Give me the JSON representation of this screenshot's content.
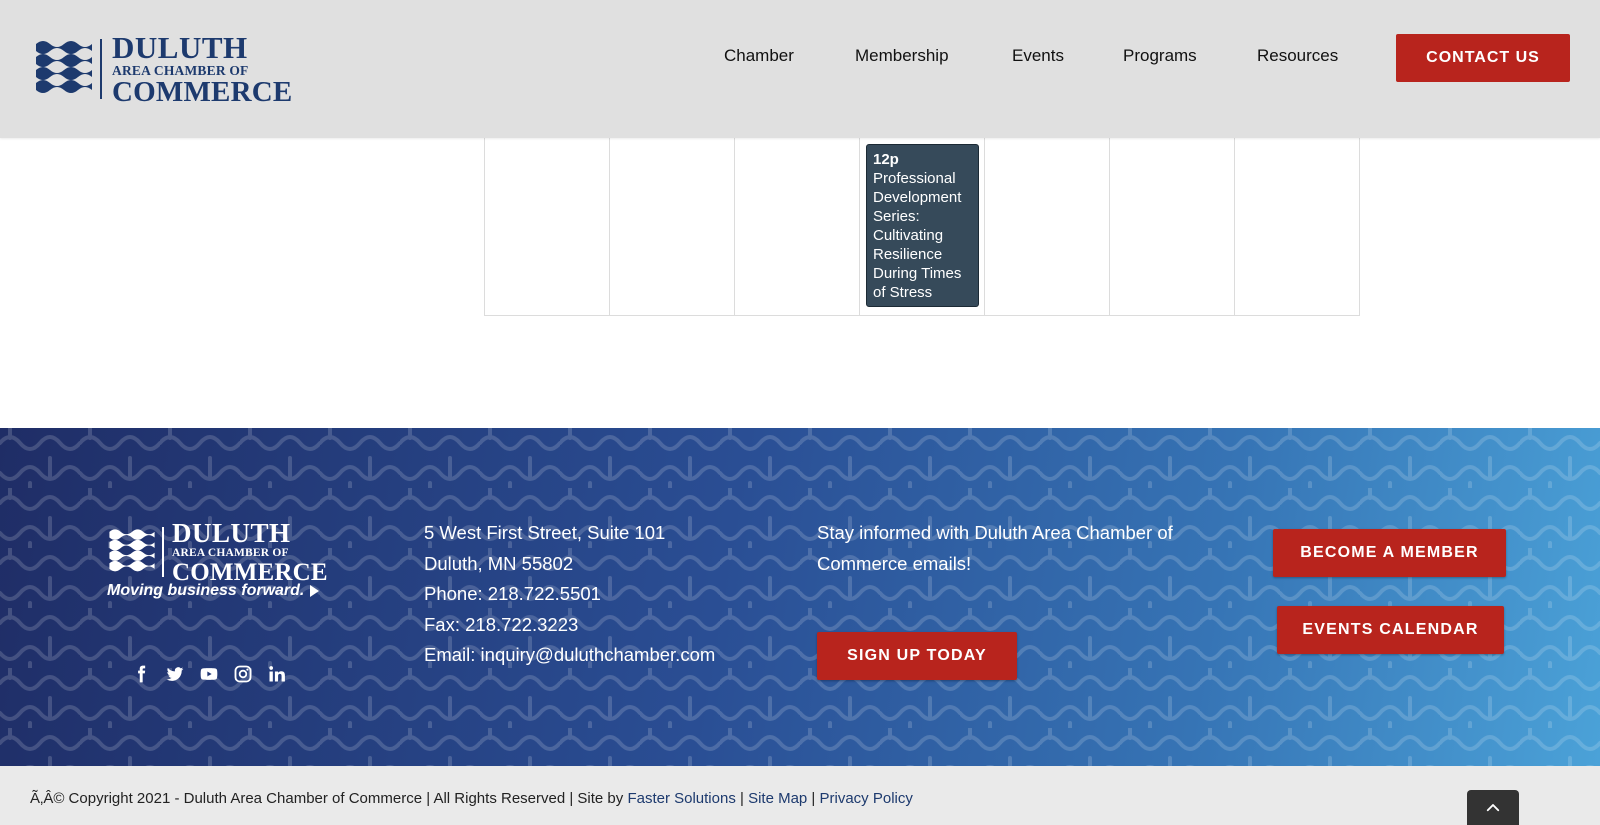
{
  "header": {
    "logo": {
      "line1": "DULUTH",
      "line2": "AREA CHAMBER OF",
      "line3": "COMMERCE"
    },
    "nav": [
      {
        "label": "Chamber"
      },
      {
        "label": "Membership"
      },
      {
        "label": "Events"
      },
      {
        "label": "Programs"
      },
      {
        "label": "Resources"
      }
    ],
    "contact_label": "CONTACT US"
  },
  "calendar": {
    "event": {
      "time": "12p",
      "title": "Professional Development Series: Cultivating Resilience During Times of Stress"
    }
  },
  "footer": {
    "logo": {
      "line1": "DULUTH",
      "line2": "AREA CHAMBER OF",
      "line3": "COMMERCE",
      "tagline": "Moving business forward."
    },
    "socials": [
      {
        "icon": "facebook-icon"
      },
      {
        "icon": "twitter-icon"
      },
      {
        "icon": "youtube-icon"
      },
      {
        "icon": "instagram-icon"
      },
      {
        "icon": "linkedin-icon"
      }
    ],
    "address": {
      "line1": "5 West First Street, Suite 101",
      "line2": "Duluth, MN 55802",
      "phone": "Phone: 218.722.5501",
      "fax": "Fax: 218.722.3223",
      "email": "Email: inquiry@duluthchamber.com"
    },
    "signup_text": "Stay informed with Duluth Area Chamber of Commerce emails!",
    "signup_label": "SIGN UP TODAY",
    "member_label": "BECOME A MEMBER",
    "events_label": "EVENTS CALENDAR"
  },
  "bottom": {
    "copyright": "Ã‚Â© Copyright 2021 - Duluth Area Chamber of Commerce | All Rights Reserved | Site by ",
    "faster": "Faster Solutions",
    "sep1": " | ",
    "sitemap": "Site Map",
    "sep2": " | ",
    "privacy": "Privacy Policy"
  },
  "colors": {
    "brand_navy": "#1d3a6e",
    "accent_red": "#b8241d",
    "event_bg": "#364a5a"
  }
}
